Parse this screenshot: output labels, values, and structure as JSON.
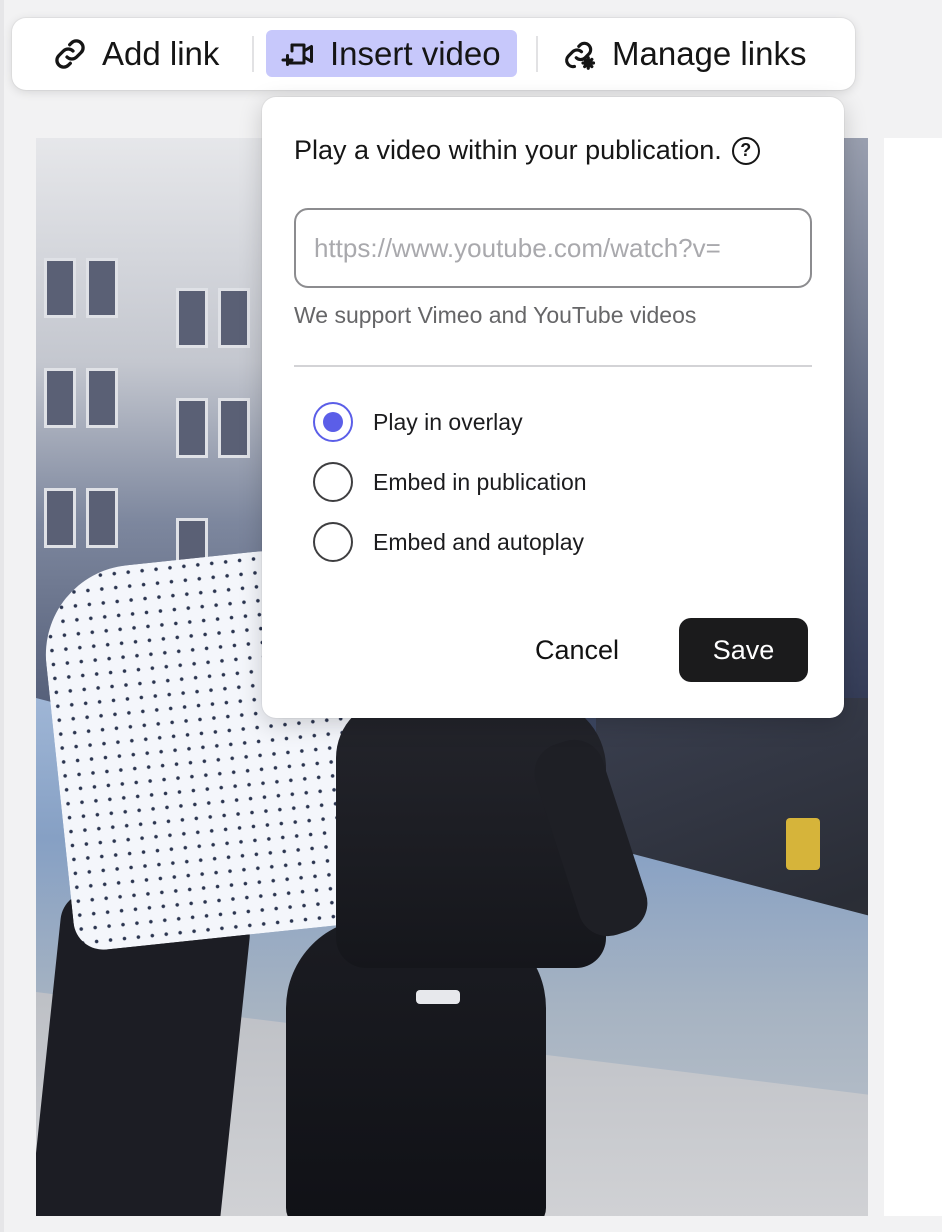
{
  "toolbar": {
    "add_link_label": "Add link",
    "add_link_icon": "link-icon",
    "insert_video_label": "Insert video",
    "insert_video_icon": "video-add-icon",
    "insert_video_active_bg": "#c7c8fb",
    "manage_links_label": "Manage links",
    "manage_links_icon": "link-settings-icon"
  },
  "popover": {
    "title": "Play a video within your publication.",
    "help_icon": "help-circle-icon",
    "url_input": {
      "placeholder": "https://www.youtube.com/watch?v=",
      "value": ""
    },
    "hint": "We support Vimeo and YouTube videos",
    "options": [
      {
        "label": "Play in overlay",
        "checked": true
      },
      {
        "label": "Embed in publication",
        "checked": false
      },
      {
        "label": "Embed and autoplay",
        "checked": false
      }
    ],
    "cancel_label": "Cancel",
    "save_label": "Save"
  },
  "colors": {
    "accent": "#5b5ee8",
    "save_bg": "#1b1b1c"
  }
}
